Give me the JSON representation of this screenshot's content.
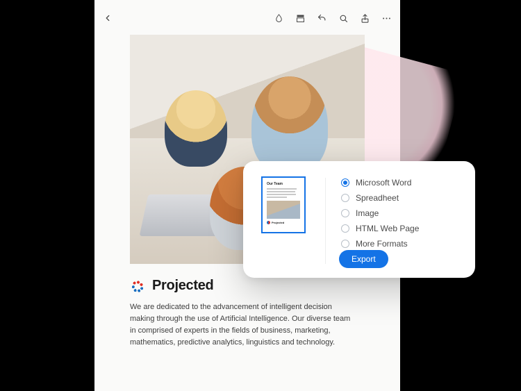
{
  "toolbar": {
    "icons": {
      "back": "chevron-left-icon",
      "droplet": "droplet-icon",
      "contrast": "panel-icon",
      "undo": "undo-icon",
      "search": "search-icon",
      "share": "share-icon",
      "more": "more-icon"
    }
  },
  "document": {
    "brand_name": "Projected",
    "body_text": "We are dedicated to the advancement of intelligent decision making through the use of Artificial Intelligence. Our diverse team in comprised of experts in the fields of business,  marketing, mathematics, predictive analytics, linguistics and technology.",
    "thumb_title": "Our Team",
    "thumb_brand": "Projected"
  },
  "export_panel": {
    "options": [
      {
        "label": "Microsoft Word",
        "selected": true
      },
      {
        "label": "Spreadheet",
        "selected": false
      },
      {
        "label": "Image",
        "selected": false
      },
      {
        "label": "HTML Web Page",
        "selected": false
      },
      {
        "label": "More Formats",
        "selected": false
      }
    ],
    "export_label": "Export"
  }
}
